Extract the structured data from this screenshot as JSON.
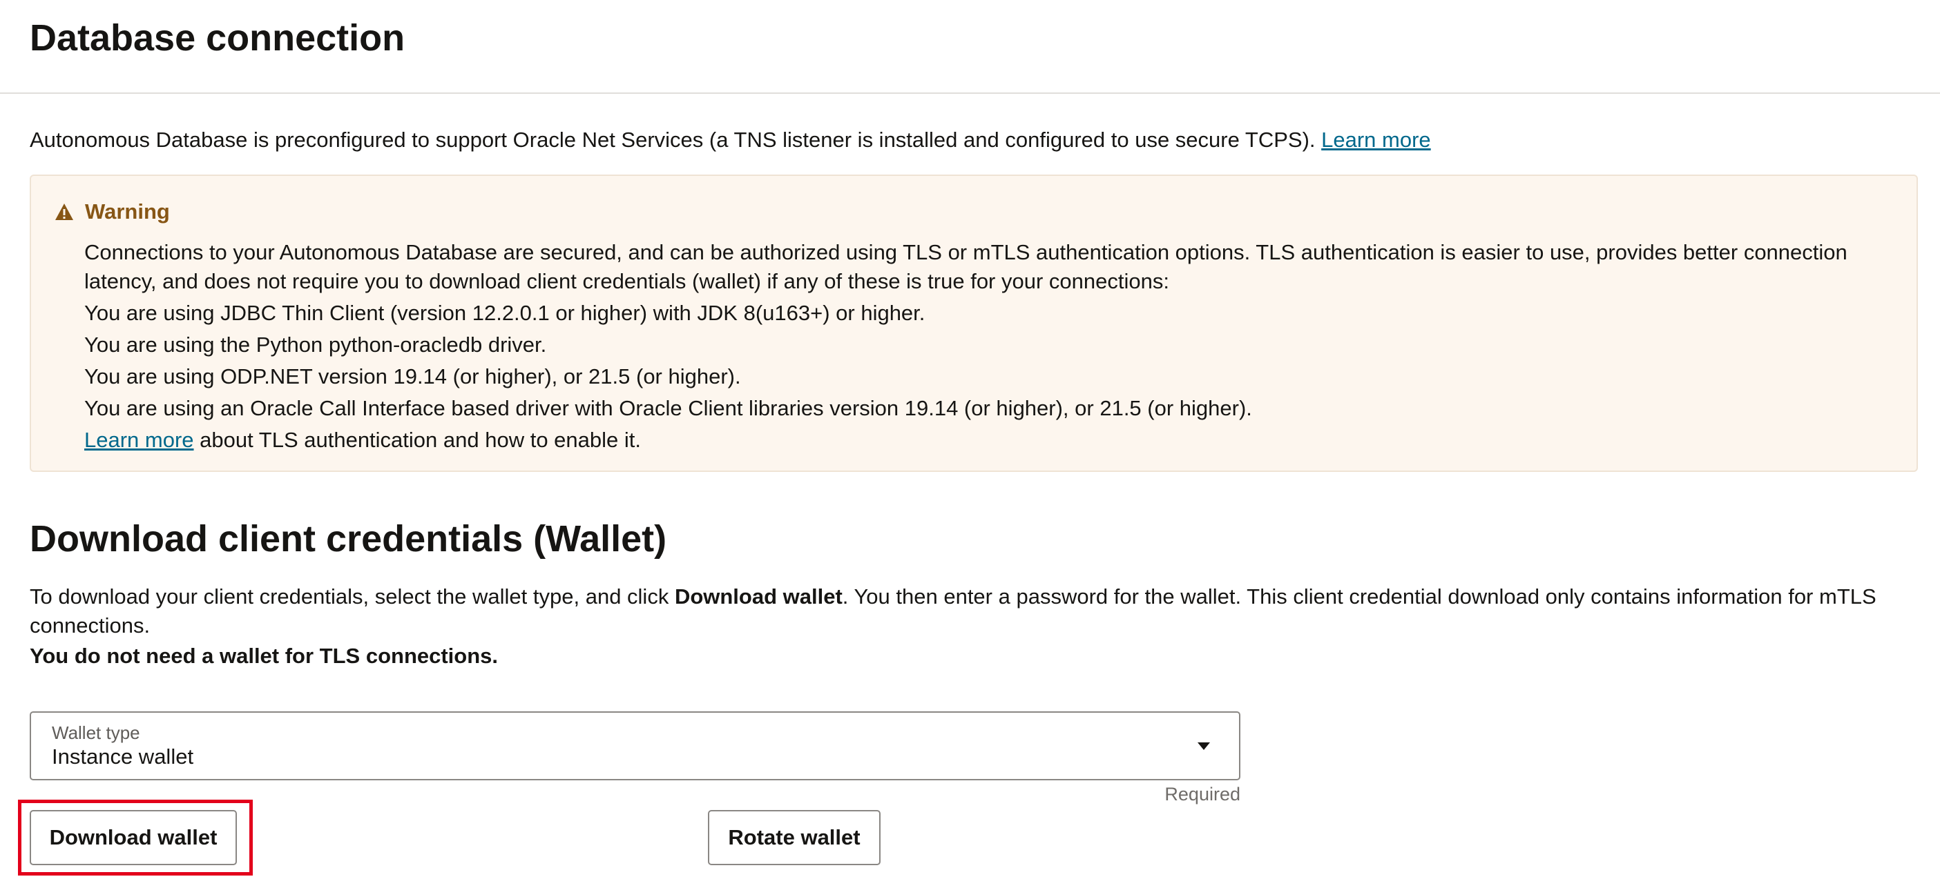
{
  "header": {
    "title": "Database connection"
  },
  "intro": {
    "text": "Autonomous Database is preconfigured to support Oracle Net Services (a TNS listener is installed and configured to use secure TCPS).",
    "link": "Learn more"
  },
  "warning": {
    "icon": "warning-triangle-icon",
    "title": "Warning",
    "paragraph": "Connections to your Autonomous Database are secured, and can be authorized using TLS or mTLS authentication options. TLS authentication is easier to use, provides better connection latency, and does not require you to download client credentials (wallet) if any of these is true for your connections:",
    "items": [
      "You are using JDBC Thin Client (version 12.2.0.1 or higher) with JDK 8(u163+) or higher.",
      "You are using the Python python-oracledb driver.",
      "You are using ODP.NET version 19.14 (or higher), or 21.5 (or higher).",
      "You are using an Oracle Call Interface based driver with Oracle Client libraries version 19.14 (or higher), or 21.5 (or higher)."
    ],
    "footer_link": "Learn more",
    "footer_text": " about TLS authentication and how to enable it."
  },
  "wallet_section": {
    "title": "Download client credentials (Wallet)",
    "desc_pre": "To download your client credentials, select the wallet type, and click ",
    "desc_bold": "Download wallet",
    "desc_post": ". You then enter a password for the wallet. This client credential download only contains information for mTLS connections.",
    "note": "You do not need a wallet for TLS connections.",
    "wallet_type": {
      "label": "Wallet type",
      "value": "Instance wallet",
      "required": "Required"
    },
    "download_button": "Download wallet",
    "rotate_button": "Rotate wallet"
  },
  "colors": {
    "link": "#00688c",
    "warning_bg": "#fdf6ee",
    "warning_title": "#875615",
    "highlight": "#e3001b"
  }
}
